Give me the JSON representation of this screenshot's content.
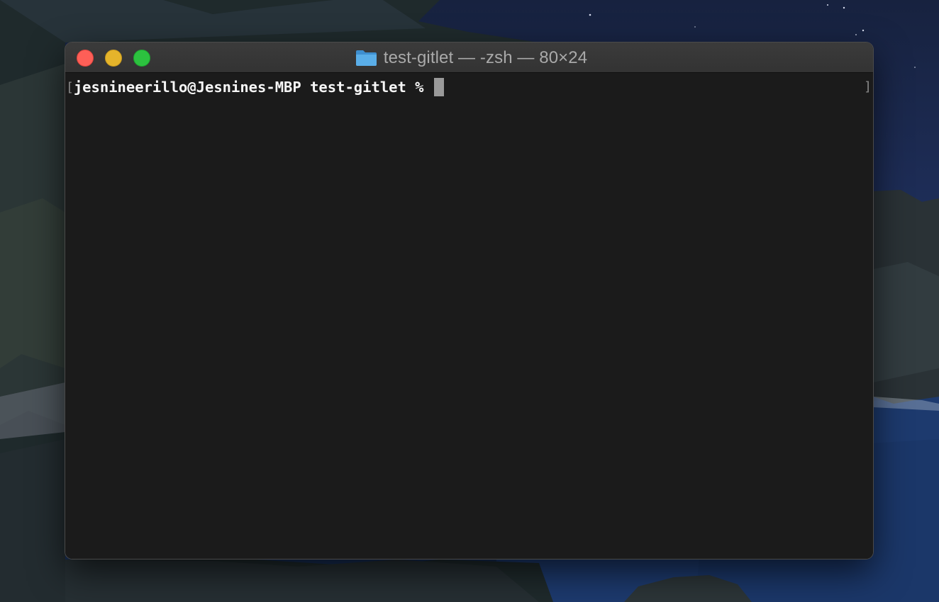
{
  "window": {
    "title": "test-gitlet — -zsh — 80×24",
    "folder_icon": "folder-icon"
  },
  "terminal": {
    "prompt": "jesnineerillo@Jesnines-MBP test-gitlet % ",
    "left_bracket": "[",
    "right_bracket": "]"
  },
  "colors": {
    "close": "#fe5f57",
    "minimize": "#e5b42b",
    "zoom": "#2cc13f",
    "terminal_bg": "#1b1b1b",
    "text": "#f2f2f2",
    "cursor": "#9a9a9a"
  }
}
